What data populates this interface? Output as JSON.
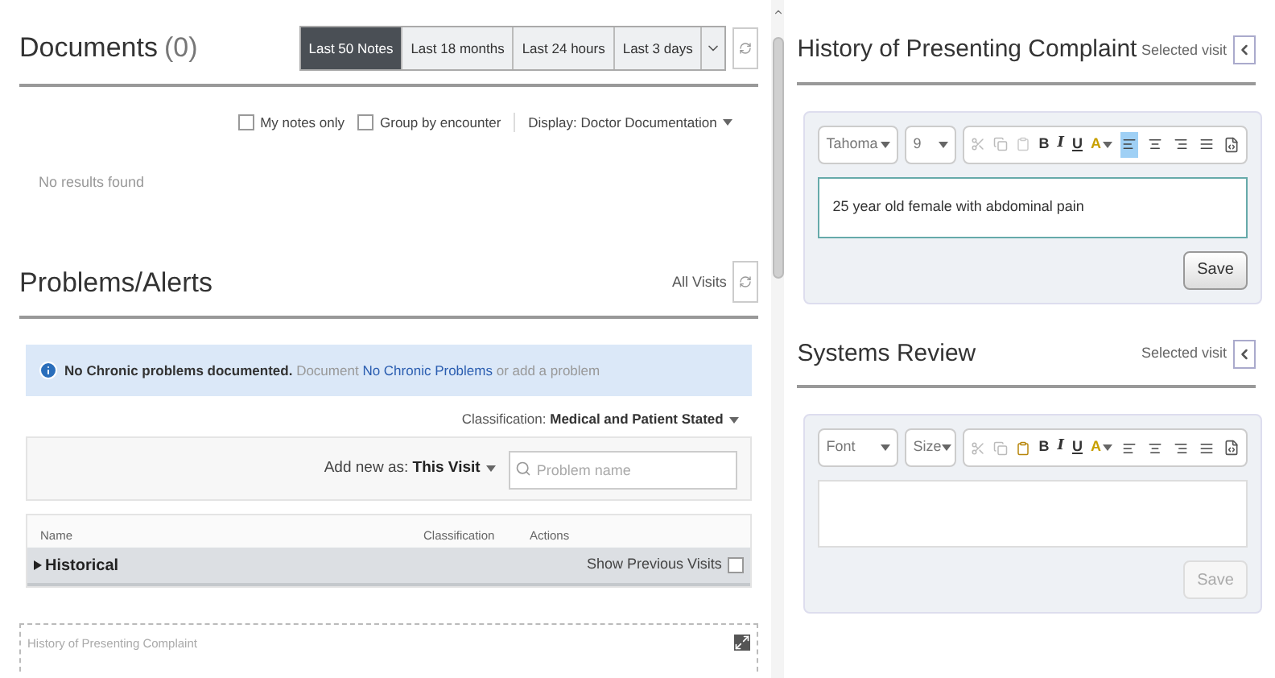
{
  "documents": {
    "title": "Documents",
    "count": "(0)",
    "filters": [
      {
        "label": "Last 50 Notes",
        "selected": true
      },
      {
        "label": "Last 18 months",
        "selected": false
      },
      {
        "label": "Last 24 hours",
        "selected": false
      },
      {
        "label": "Last 3 days",
        "selected": false
      }
    ],
    "options": [
      {
        "label": "My notes only",
        "checked": false
      },
      {
        "label": "Group by encounter",
        "checked": false
      }
    ],
    "display": "Display: Doctor Documentation",
    "empty": "No results found"
  },
  "problems": {
    "title": "Problems/Alerts",
    "scope": "All Visits",
    "alert": {
      "bold": "No Chronic problems documented.",
      "prefix": "Document",
      "link": "No Chronic Problems",
      "suffix": "or add a problem"
    },
    "classification_label": "Classification:",
    "classification_value": "Medical and Patient Stated",
    "add_new_label": "Add new as:",
    "add_new_value": "This Visit",
    "search_placeholder": "Problem name",
    "columns": [
      "Name",
      "Classification",
      "Actions"
    ],
    "groups": [
      {
        "label": "Historical",
        "expanded": false
      }
    ],
    "show_previous": {
      "label": "Show Previous Visits",
      "checked": false
    }
  },
  "collapsed_panel": {
    "title": "History of Presenting Complaint"
  },
  "editors": [
    {
      "title": "History of Presenting Complaint",
      "visit_label": "Selected visit",
      "font": "Tahoma",
      "size": "9",
      "paste_enabled": false,
      "bold": "B",
      "italic": "I",
      "underline": "U",
      "color_label": "A",
      "alignments": [
        {
          "selected": true
        },
        {
          "selected": false
        },
        {
          "selected": false
        },
        {
          "selected": false
        }
      ],
      "value": "25 year old female with abdominal pain",
      "focused": true,
      "save": "Save",
      "save_disabled": false
    },
    {
      "title": "Systems Review",
      "visit_label": "Selected visit",
      "font": "Font",
      "size": "Size",
      "paste_enabled": true,
      "bold": "B",
      "italic": "I",
      "underline": "U",
      "color_label": "A",
      "alignments": [
        {
          "selected": false
        },
        {
          "selected": false
        },
        {
          "selected": false
        },
        {
          "selected": false
        }
      ],
      "focused": false,
      "save": "Save",
      "save_disabled": true
    }
  ]
}
